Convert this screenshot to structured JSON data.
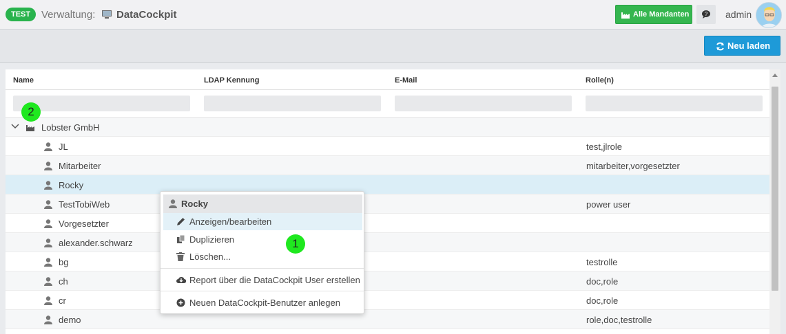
{
  "header": {
    "env_badge": "TEST",
    "section_label": "Verwaltung:",
    "app_name": "DataCockpit",
    "mandanten_button": "Alle Mandanten",
    "user_name": "admin"
  },
  "toolbar": {
    "reload_label": "Neu laden"
  },
  "grid": {
    "columns": [
      "Name",
      "LDAP Kennung",
      "E-Mail",
      "Rolle(n)"
    ],
    "group": {
      "label": "Lobster GmbH"
    },
    "rows": [
      {
        "name": "JL",
        "ldap": "",
        "email": "",
        "roles": "test,jlrole"
      },
      {
        "name": "Mitarbeiter",
        "ldap": "",
        "email": "",
        "roles": "mitarbeiter,vorgesetzter"
      },
      {
        "name": "Rocky",
        "ldap": "",
        "email": "",
        "roles": ""
      },
      {
        "name": "TestTobiWeb",
        "ldap": "",
        "email": "",
        "roles": "power user"
      },
      {
        "name": "Vorgesetzter",
        "ldap": "",
        "email": "",
        "roles": ""
      },
      {
        "name": "alexander.schwarz",
        "ldap": "",
        "email": "",
        "roles": ""
      },
      {
        "name": "bg",
        "ldap": "",
        "email": "",
        "roles": "testrolle"
      },
      {
        "name": "ch",
        "ldap": "",
        "email": "",
        "roles": "doc,role"
      },
      {
        "name": "cr",
        "ldap": "",
        "email": "",
        "roles": "doc,role"
      },
      {
        "name": "demo",
        "ldap": "",
        "email": "",
        "roles": "role,doc,testrolle"
      }
    ]
  },
  "context_menu": {
    "title": "Rocky",
    "items": [
      {
        "label": "Anzeigen/bearbeiten",
        "icon": "pencil-icon"
      },
      {
        "label": "Duplizieren",
        "icon": "copy-icon"
      },
      {
        "label": "Löschen...",
        "icon": "trash-icon"
      },
      {
        "label": "Report über die DataCockpit User erstellen",
        "icon": "cloud-download-icon"
      },
      {
        "label": "Neuen DataCockpit-Benutzer anlegen",
        "icon": "plus-circle-icon"
      }
    ]
  },
  "markers": {
    "one": "1",
    "two": "2"
  },
  "colors": {
    "accent_green": "#35b64f",
    "accent_blue": "#1e9ad8",
    "selected_row": "#dbeef7",
    "marker": "#1fe81f"
  }
}
